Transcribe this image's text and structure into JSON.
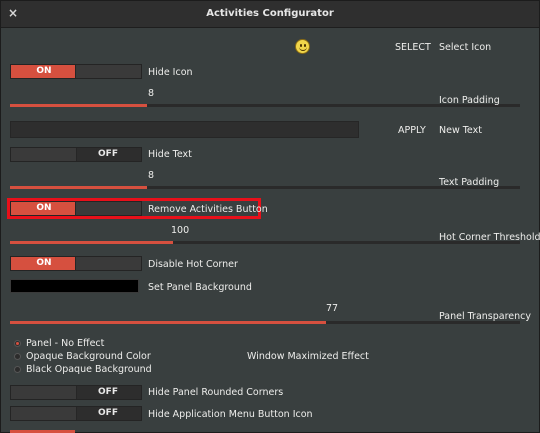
{
  "window": {
    "title": "Activities Configurator",
    "close_glyph": "×"
  },
  "colors": {
    "accent": "#d6503f",
    "background": "#393f3f",
    "highlight": "#e8101a",
    "panel_background_swatch": "#000000"
  },
  "icon": {
    "select_label": "SELECT",
    "label": "Select Icon",
    "preview_icon": "smiley-face-icon"
  },
  "hide_icon": {
    "state": "ON",
    "label": "Hide Icon"
  },
  "icon_padding": {
    "value": "8",
    "label": "Icon Padding",
    "level": 0.27
  },
  "new_text": {
    "apply_label": "APPLY",
    "label": "New Text",
    "value": ""
  },
  "hide_text": {
    "state": "OFF",
    "label": "Hide Text"
  },
  "text_padding": {
    "value": "8",
    "label": "Text Padding",
    "level": 0.27
  },
  "remove_activities": {
    "state": "ON",
    "label": "Remove Activities Button"
  },
  "hot_corner_threshold": {
    "value": "100",
    "label": "Hot Corner Threshold",
    "level": 0.32
  },
  "disable_hot_corner": {
    "state": "ON",
    "label": "Disable Hot Corner"
  },
  "panel_background": {
    "label": "Set Panel Background"
  },
  "panel_transparency": {
    "value": "77",
    "label": "Panel Transparency",
    "level": 0.6
  },
  "maximized_effect": {
    "label": "Window Maximized Effect",
    "options": [
      "Panel - No Effect",
      "Opaque Background Color",
      "Black Opaque Background"
    ],
    "selected": 0
  },
  "hide_rounded_corners": {
    "state": "OFF",
    "label": "Hide Panel Rounded Corners"
  },
  "hide_app_menu_icon": {
    "state": "OFF",
    "label": "Hide Application Menu Button Icon"
  }
}
